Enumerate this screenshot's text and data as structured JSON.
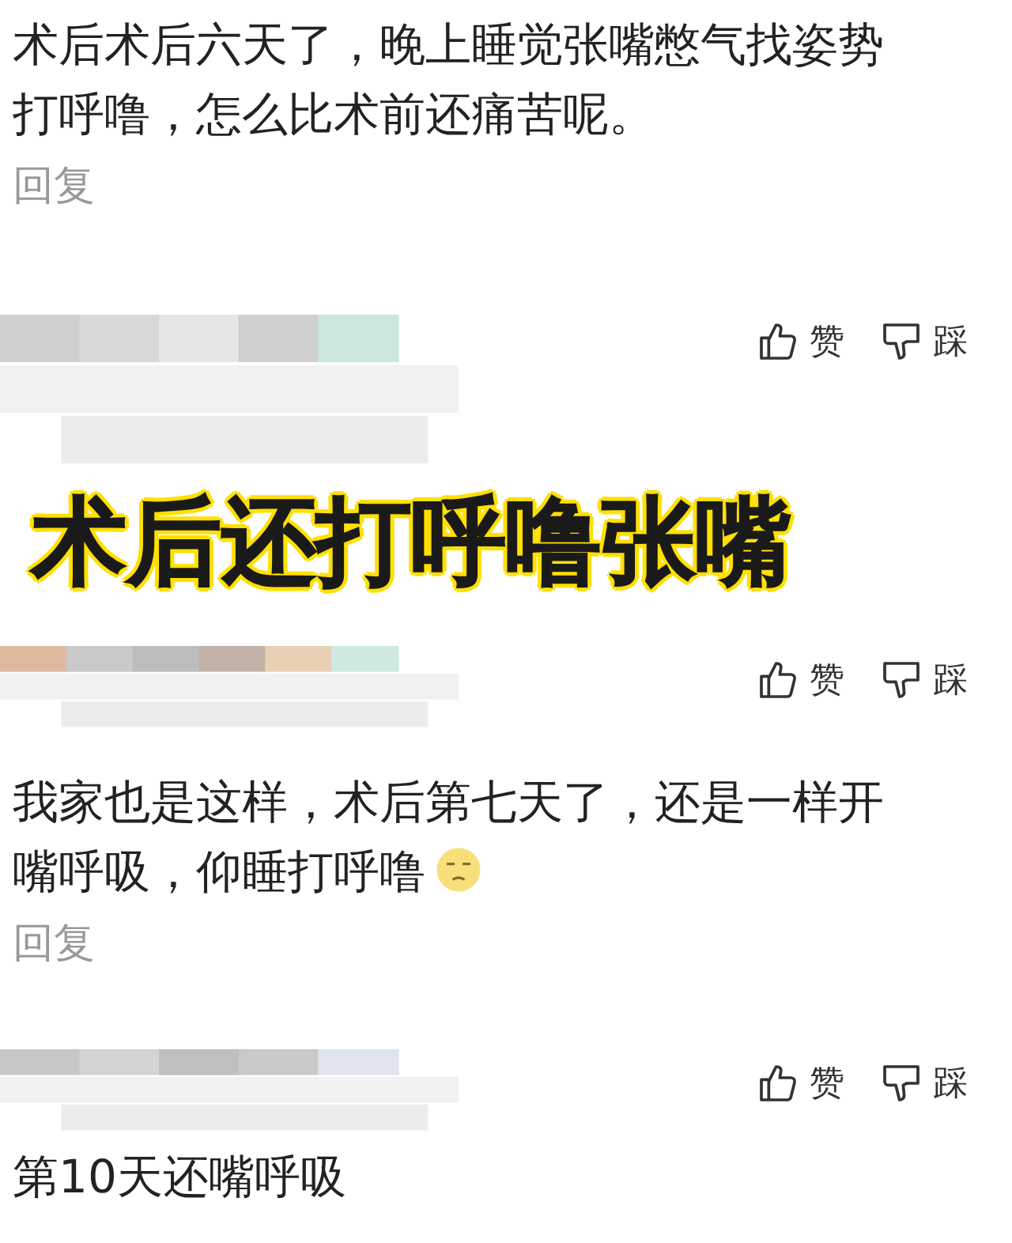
{
  "comments": [
    {
      "text": "术后术后六天了，晚上睡觉张嘴憋气找姿势打呼噜，怎么比术前还痛苦呢。",
      "reply": "回复"
    },
    {
      "like": "赞",
      "dislike": "踩",
      "caption": "术后还打呼噜张嘴"
    },
    {
      "like": "赞",
      "dislike": "踩",
      "text": "我家也是这样，术后第七天了，还是一样开嘴呼吸，仰睡打呼噜",
      "emoji": true,
      "reply": "回复"
    },
    {
      "like": "赞",
      "dislike": "踩",
      "text": "第10天还嘴呼吸"
    }
  ]
}
